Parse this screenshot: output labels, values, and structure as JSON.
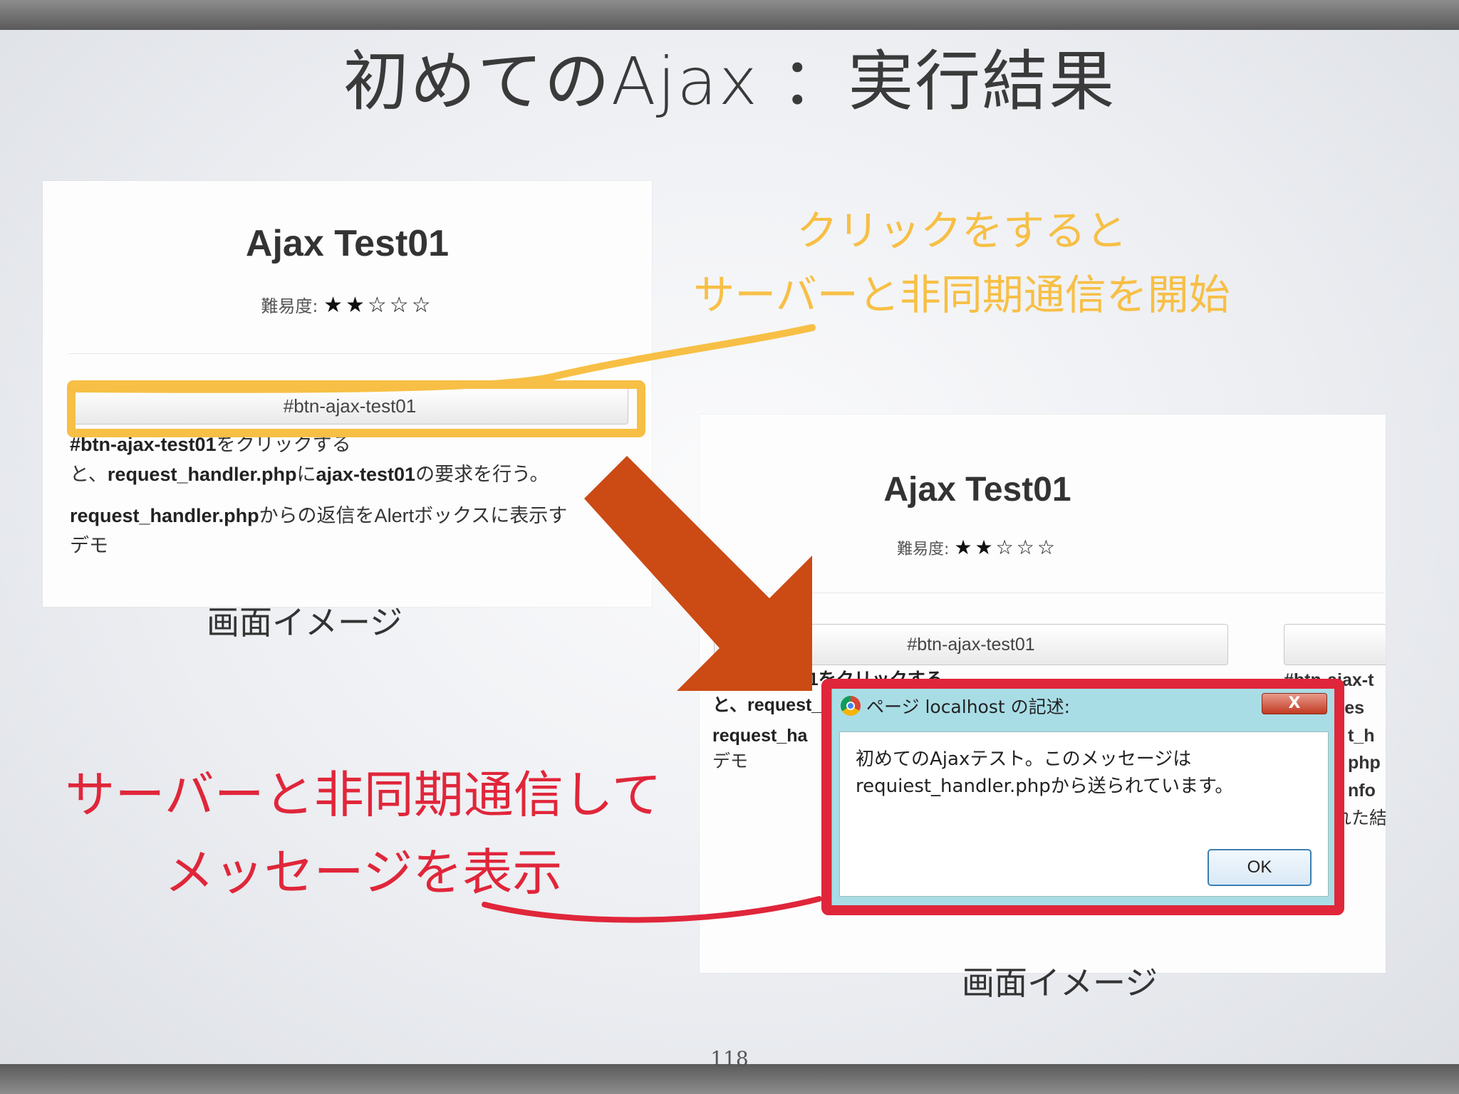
{
  "slide": {
    "title": "初めてのAjax ：実行結果",
    "page_number": "118"
  },
  "screen1": {
    "title": "Ajax Test01",
    "difficulty_label": "難易度:",
    "stars": "★★☆☆☆",
    "button_label": "#btn-ajax-test01",
    "desc_line1_bold": "#btn-ajax-test01",
    "desc_line1_rest": "をクリックする",
    "desc_line2_pre": "と、",
    "desc_line2_bold1": "request_handler.php",
    "desc_line2_mid": "に",
    "desc_line2_bold2": "ajax-test01",
    "desc_line2_rest": "の要求を行う。",
    "desc_line3_bold": "request_handler.php",
    "desc_line3_rest": "からの返信をAlertボックスに表示す",
    "desc_line4": "デモ",
    "caption": "画面イメージ"
  },
  "screen2": {
    "title": "Ajax Test01",
    "difficulty_label": "難易度:",
    "stars": "★★☆☆☆",
    "button_label": "#btn-ajax-test01",
    "partial_line1": "#",
    "partial_line1b": "test01をクリックする",
    "partial_line2": "と、request_",
    "partial_line3": "request_ha",
    "partial_line4": "デモ",
    "right_fragments": [
      "#btn-ajax-t",
      "ues",
      "t_h",
      "php",
      "nfo",
      "れた結"
    ],
    "caption": "画面イメージ"
  },
  "alert_dialog": {
    "title": "ページ localhost の記述:",
    "close_label": "X",
    "message_line1": "初めてのAjaxテスト。このメッセージは",
    "message_line2": "requiest_handler.phpから送られています。",
    "ok_label": "OK"
  },
  "annotations": {
    "orange_line1": "クリックをすると",
    "orange_line2": "サーバーと非同期通信を開始",
    "red_line1": "サーバーと非同期通信して",
    "red_line2": "メッセージを表示",
    "orange_color": "#f7bf45",
    "red_color": "#e0263a",
    "arrow_color": "#cc4a14"
  }
}
